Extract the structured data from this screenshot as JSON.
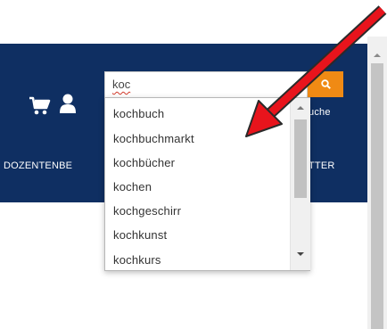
{
  "navbar": {
    "background": "#0f2f62",
    "links": {
      "dozenten": "DOZENTENBE",
      "tter": "TTER",
      "suche": "uche"
    },
    "icons": [
      "cart-icon",
      "user-icon"
    ]
  },
  "search": {
    "value": "koc",
    "button_icon": "search-icon",
    "button_color": "#f08a14"
  },
  "suggestions": [
    "kochbuch",
    "kochbuchmarkt",
    "kochbücher",
    "kochen",
    "kochgeschirr",
    "kochkunst",
    "kochkurs"
  ],
  "annotation": {
    "type": "red arrow",
    "color": "#e8141c"
  }
}
